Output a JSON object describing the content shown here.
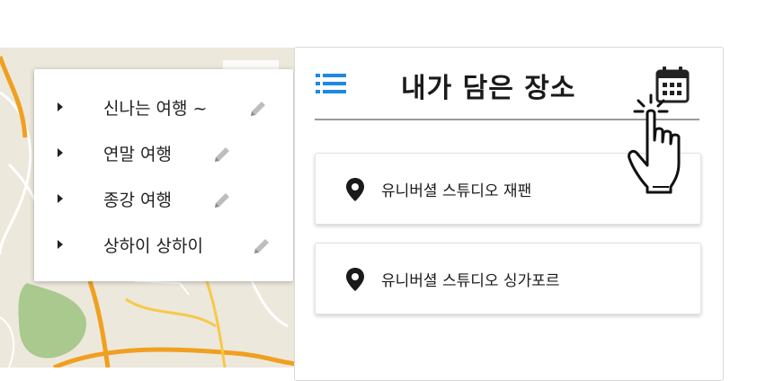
{
  "trips": {
    "items": [
      {
        "label": "신나는 여행 ~",
        "edit_icon": "pencil-icon"
      },
      {
        "label": "연말 여행",
        "edit_icon": "pencil-icon"
      },
      {
        "label": "종강 여행",
        "edit_icon": "pencil-icon"
      },
      {
        "label": "상하이 상하이",
        "edit_icon": "pencil-icon"
      }
    ]
  },
  "panel": {
    "title": "내가 담은 장소",
    "list_icon": "list-icon",
    "calendar_icon": "calendar-icon",
    "places": [
      {
        "name": "유니버셜 스튜디오 재팬",
        "icon": "map-pin-icon"
      },
      {
        "name": "유니버셜 스튜디오 싱가포르",
        "icon": "map-pin-icon"
      }
    ]
  },
  "colors": {
    "accent_blue": "#1e88e5",
    "map_bg": "#ede8dc",
    "road_orange": "#f0a020",
    "park_green": "#a9c98f"
  },
  "cursor_icon": "hand-pointer-icon"
}
